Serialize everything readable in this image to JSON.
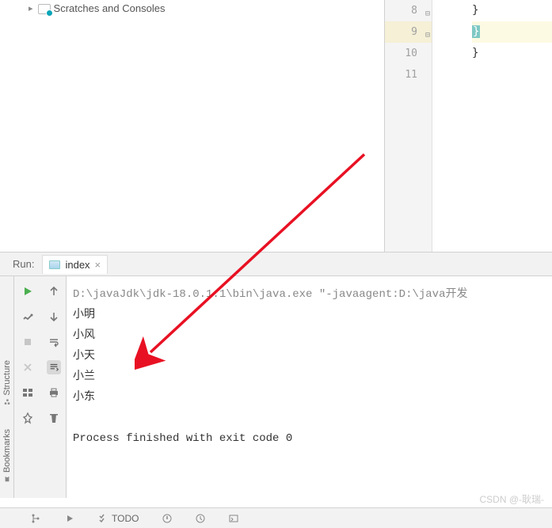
{
  "project": {
    "scratches_label": "Scratches and Consoles"
  },
  "editor": {
    "lines": {
      "n8": "8",
      "n9": "9",
      "n10": "10",
      "n11": "11"
    },
    "code": {
      "l8": "}",
      "l9": "}",
      "l10": "}",
      "l11": ""
    }
  },
  "run": {
    "label": "Run:",
    "tab_name": "index"
  },
  "output": {
    "command": "D:\\javaJdk\\jdk-18.0.1.1\\bin\\java.exe \"-javaagent:D:\\java开发",
    "lines": [
      "小明",
      "小风",
      "小天",
      "小兰",
      "小东"
    ],
    "exit_msg": "Process finished with exit code 0"
  },
  "sidebar": {
    "structure": "Structure",
    "bookmarks": "Bookmarks"
  },
  "status": {
    "todo": "TODO"
  },
  "watermark": "CSDN @-耿瑞-"
}
